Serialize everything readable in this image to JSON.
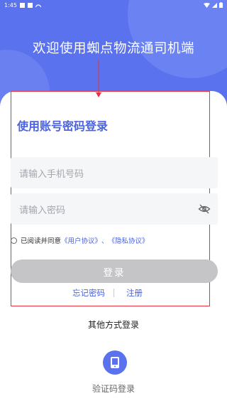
{
  "status_bar": {
    "time": "1:45"
  },
  "hero": {
    "headline": "欢迎使用蜘点物流通司机端"
  },
  "login": {
    "title": "使用账号密码登录",
    "phone_placeholder": "请输入手机号码",
    "password_placeholder": "请输入密码",
    "agreement_prefix": "已阅读并同意",
    "user_agreement": "《用户协议》",
    "separator": "、",
    "privacy_policy": "《隐私协议》",
    "login_button": "登录",
    "forgot_password": "忘记密码",
    "register": "注册"
  },
  "alternatives": {
    "title": "其他方式登录",
    "code_login_label": "验证码登录",
    "code_login_icon": "phone-icon"
  },
  "colors": {
    "brand": "#5a72ee",
    "link": "#4a63e0",
    "annotation": "#e6323e",
    "disabled_button": "#c5c5c8"
  }
}
